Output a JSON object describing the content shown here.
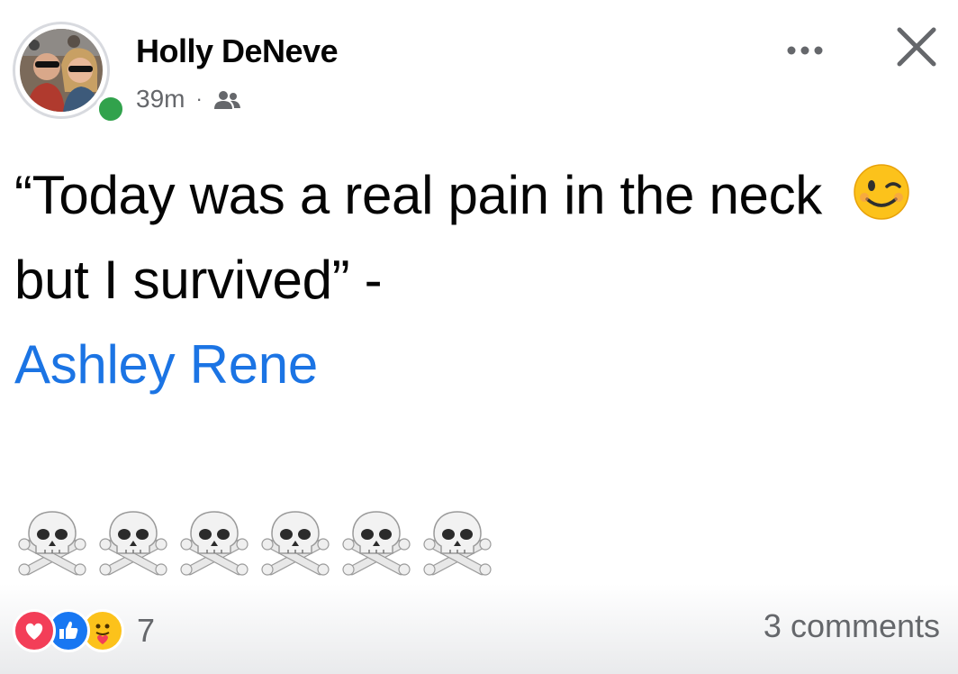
{
  "post": {
    "author": "Holly DeNeve",
    "timestamp": "39m",
    "separator": "·",
    "audience_icon": "friends-icon",
    "online": true,
    "text_part1": "“Today was a real pain in the neck",
    "text_emoji": "winking-face-emoji",
    "text_part2": "but I survived” -",
    "mention": "Ashley Rene",
    "skull_emojis": [
      "skull-and-crossbones",
      "skull-and-crossbones",
      "skull-and-crossbones",
      "skull-and-crossbones",
      "skull-and-crossbones",
      "skull-and-crossbones"
    ]
  },
  "header_actions": {
    "more_icon": "more-options-icon",
    "close_icon": "close-icon"
  },
  "footer": {
    "reactions": [
      "love-reaction-icon",
      "like-reaction-icon",
      "care-reaction-icon"
    ],
    "reaction_count": "7",
    "comments_label": "3 comments"
  },
  "colors": {
    "online": "#31a24c",
    "mention": "#1b74e4",
    "secondary_text": "#65676b",
    "like_blue": "#1877f2",
    "love_red": "#f33e58"
  }
}
